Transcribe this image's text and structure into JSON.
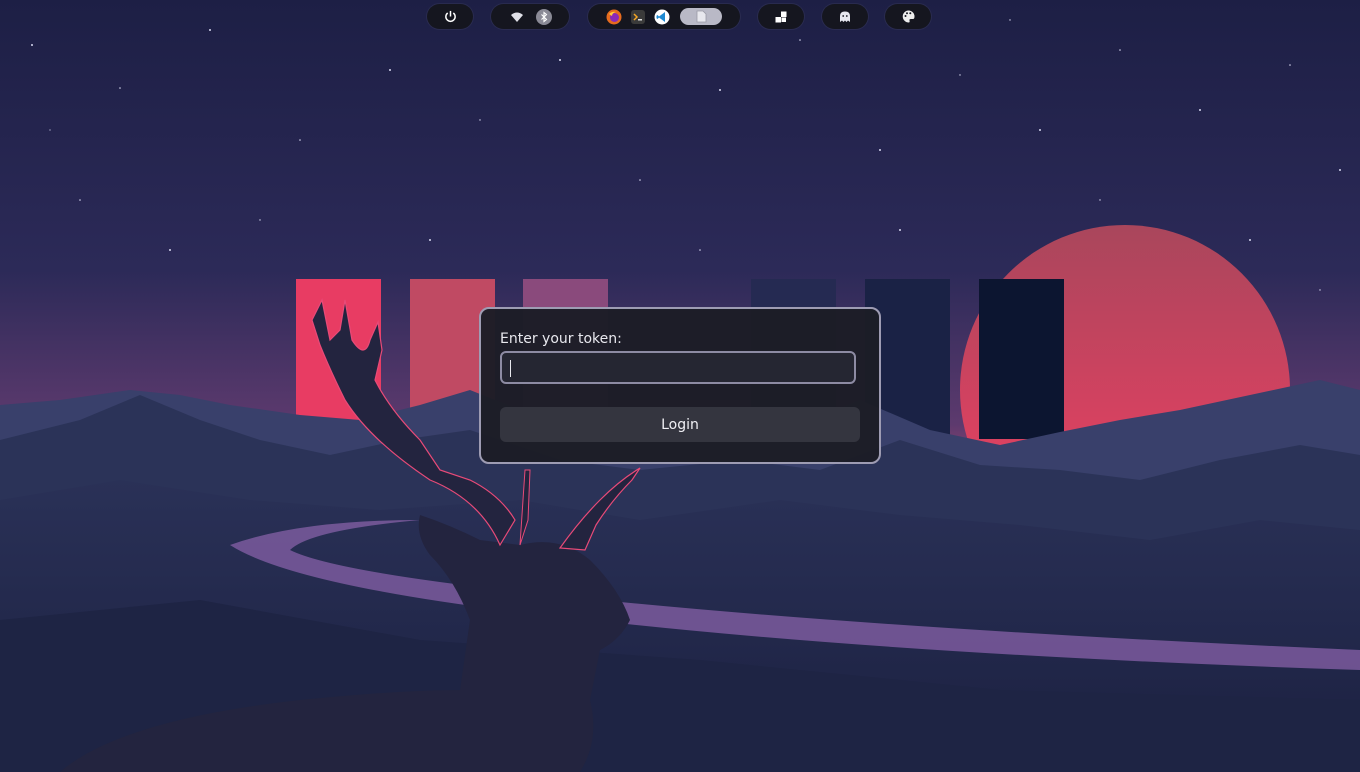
{
  "topbar": {
    "power": {
      "icon": "power-icon"
    },
    "network": {
      "wifi_icon": "wifi-icon",
      "bluetooth_icon": "bluetooth-icon"
    },
    "apps": [
      {
        "icon": "firefox-icon"
      },
      {
        "icon": "terminal-app-icon"
      },
      {
        "icon": "vscode-icon"
      },
      {
        "icon": "document-icon",
        "active": true
      }
    ],
    "workspace": {
      "icon": "workspace-icon"
    },
    "ghost": {
      "icon": "ghost-icon"
    },
    "theme": {
      "icon": "palette-icon"
    }
  },
  "dialog": {
    "label": "Enter your token:",
    "input_value": "",
    "input_placeholder": "",
    "login_label": "Login"
  },
  "colors": {
    "sky_top": "#1f2148",
    "sky_bottom": "#6a3c73",
    "sun": "#e6405e",
    "accent_pink": "#e83c63",
    "dialog_bg": "#1c1d26",
    "dialog_border": "#9e9cb3",
    "button_bg": "#34353f"
  },
  "wallpaper": {
    "subject": "deer-silhouette"
  }
}
